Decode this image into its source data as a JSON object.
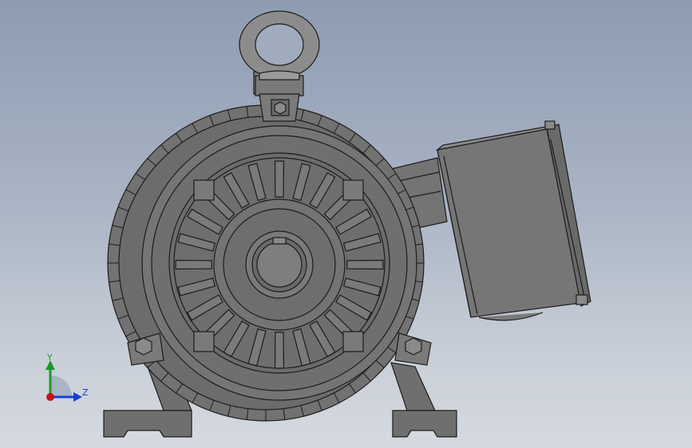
{
  "viewport": {
    "background_top": "#8e9cb2",
    "background_bottom": "#d6dae0",
    "model": {
      "name": "electric-motor",
      "body_color": "#6f6f6f",
      "edge_color": "#1c1c1c",
      "highlight_color": "#9a9a9a"
    }
  },
  "triad": {
    "y_label": "Y",
    "z_label": "Z",
    "y_color": "#1a9a2a",
    "z_color": "#1a3fd0",
    "origin_color": "#c81414",
    "icon": "coordinate-triad-icon"
  }
}
